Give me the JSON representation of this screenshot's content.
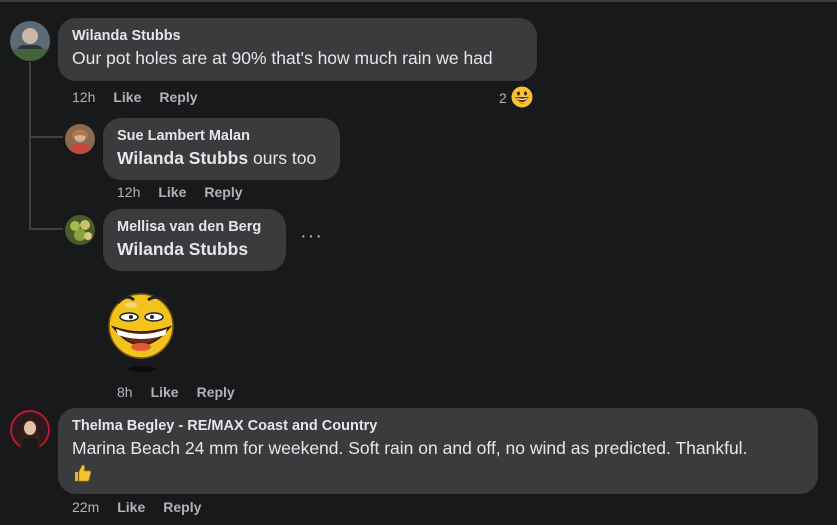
{
  "comments": [
    {
      "author": "Wilanda Stubbs",
      "text": "Our pot holes are at 90% that's how much rain we had",
      "time": "12h",
      "like_label": "Like",
      "reply_label": "Reply",
      "reaction_count": "2"
    },
    {
      "author": "Sue Lambert Malan",
      "mention": "Wilanda Stubbs",
      "text": "ours too",
      "time": "12h",
      "like_label": "Like",
      "reply_label": "Reply"
    },
    {
      "author": "Mellisa van den Berg",
      "mention": "Wilanda Stubbs",
      "more_label": "···",
      "time": "8h",
      "like_label": "Like",
      "reply_label": "Reply"
    },
    {
      "author": "Thelma Begley - RE/MAX Coast and Country",
      "text": "Marina Beach 24 mm for weekend. Soft rain on and off, no wind as predicted. Thankful.",
      "time": "22m",
      "like_label": "Like",
      "reply_label": "Reply"
    }
  ],
  "icons": {
    "reaction": "grinning-face-icon",
    "sticker": "laughing-face-sticker",
    "emoji": "thumbs-up-icon"
  }
}
